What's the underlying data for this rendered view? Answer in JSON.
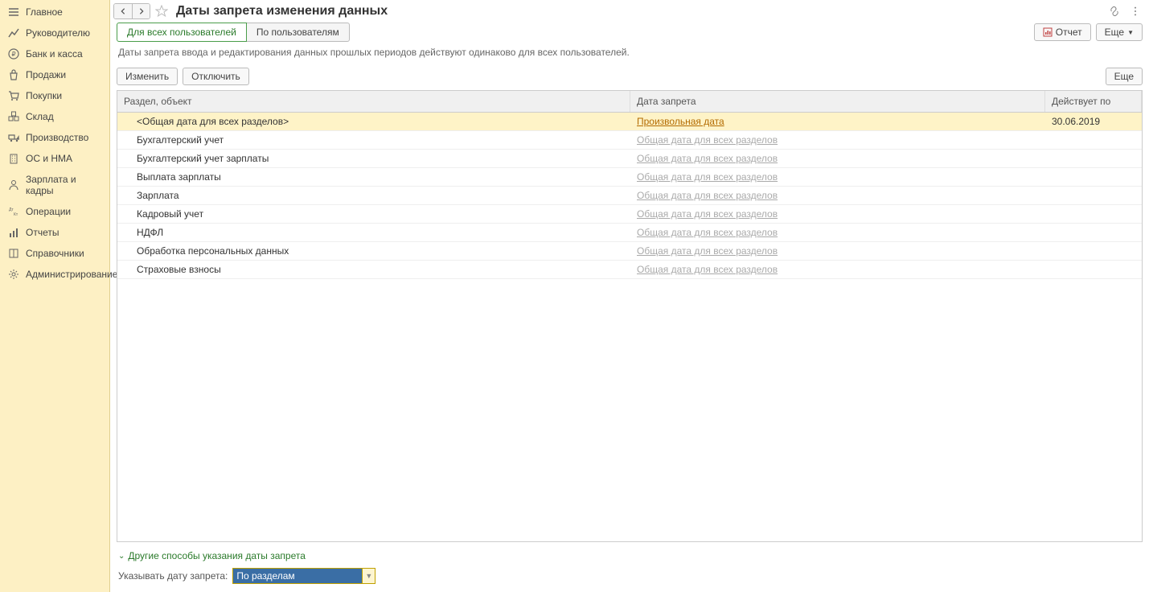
{
  "sidebar": {
    "items": [
      {
        "label": "Главное",
        "icon": "menu"
      },
      {
        "label": "Руководителю",
        "icon": "chart"
      },
      {
        "label": "Банк и касса",
        "icon": "ruble"
      },
      {
        "label": "Продажи",
        "icon": "bag"
      },
      {
        "label": "Покупки",
        "icon": "cart"
      },
      {
        "label": "Склад",
        "icon": "boxes"
      },
      {
        "label": "Производство",
        "icon": "truck"
      },
      {
        "label": "ОС и НМА",
        "icon": "building"
      },
      {
        "label": "Зарплата и кадры",
        "icon": "person"
      },
      {
        "label": "Операции",
        "icon": "ops"
      },
      {
        "label": "Отчеты",
        "icon": "bars"
      },
      {
        "label": "Справочники",
        "icon": "book"
      },
      {
        "label": "Администрирование",
        "icon": "gear"
      }
    ]
  },
  "header": {
    "title": "Даты запрета изменения данных"
  },
  "tabs": {
    "items": [
      {
        "label": "Для всех пользователей",
        "active": true
      },
      {
        "label": "По пользователям",
        "active": false
      }
    ],
    "report_label": "Отчет",
    "more_label": "Еще"
  },
  "info_text": "Даты запрета ввода и редактирования данных прошлых периодов действуют одинаково для всех пользователей.",
  "toolbar": {
    "edit_label": "Изменить",
    "disable_label": "Отключить",
    "more_label": "Еще"
  },
  "table": {
    "columns": {
      "section": "Раздел, объект",
      "date": "Дата запрета",
      "effective": "Действует по"
    },
    "rows": [
      {
        "section": "<Общая дата для всех разделов>",
        "date": "Произвольная дата",
        "date_style": "orange",
        "effective": "30.06.2019",
        "selected": true
      },
      {
        "section": "Бухгалтерский учет",
        "date": "Общая дата для всех разделов",
        "date_style": "gray",
        "effective": ""
      },
      {
        "section": "Бухгалтерский учет зарплаты",
        "date": "Общая дата для всех разделов",
        "date_style": "gray",
        "effective": ""
      },
      {
        "section": "Выплата зарплаты",
        "date": "Общая дата для всех разделов",
        "date_style": "gray",
        "effective": ""
      },
      {
        "section": "Зарплата",
        "date": "Общая дата для всех разделов",
        "date_style": "gray",
        "effective": ""
      },
      {
        "section": "Кадровый учет",
        "date": "Общая дата для всех разделов",
        "date_style": "gray",
        "effective": ""
      },
      {
        "section": "НДФЛ",
        "date": "Общая дата для всех разделов",
        "date_style": "gray",
        "effective": ""
      },
      {
        "section": "Обработка персональных данных",
        "date": "Общая дата для всех разделов",
        "date_style": "gray",
        "effective": ""
      },
      {
        "section": "Страховые взносы",
        "date": "Общая дата для всех разделов",
        "date_style": "gray",
        "effective": ""
      }
    ]
  },
  "bottom": {
    "expand_label": "Другие способы указания даты запрета",
    "form_label": "Указывать дату запрета:",
    "select_value": "По разделам"
  }
}
